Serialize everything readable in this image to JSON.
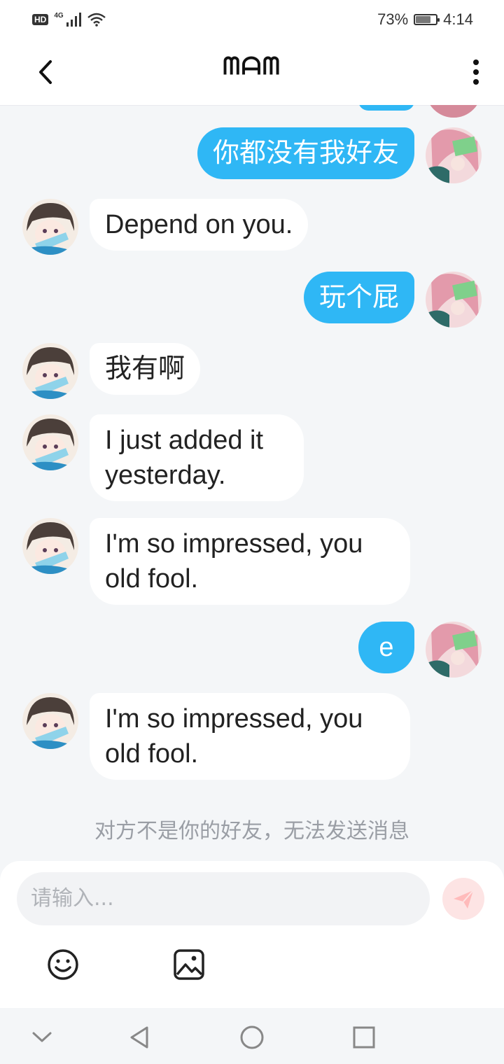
{
  "status_bar": {
    "hd": "HD",
    "network": "4G",
    "battery_percent": "73%",
    "battery_level": 0.73,
    "time": "4:14"
  },
  "header": {
    "title": "ᗰᗩᗰ",
    "back_icon": "chevron-left-icon",
    "more_icon": "more-vertical-icon"
  },
  "messages": [
    {
      "side": "right",
      "text": "你都没有我好友"
    },
    {
      "side": "left",
      "text": "Depend on you."
    },
    {
      "side": "right",
      "text": "玩个屁"
    },
    {
      "side": "left",
      "text": "我有啊"
    },
    {
      "side": "left",
      "text": "I just added it yesterday."
    },
    {
      "side": "left",
      "text": "I'm so impressed, you old fool."
    },
    {
      "side": "right",
      "text": "e"
    },
    {
      "side": "left",
      "text": "I'm so impressed, you old fool."
    }
  ],
  "notice": "对方不是你的好友，无法发送消息",
  "composer": {
    "placeholder": "请输入...",
    "send_icon": "send-icon",
    "emoji_icon": "emoji-icon",
    "image_icon": "image-icon"
  },
  "nav_bar": {
    "icons": [
      "chevron-down-icon",
      "back-triangle-icon",
      "home-circle-icon",
      "recents-square-icon"
    ]
  },
  "colors": {
    "accent": "#2fb7f5",
    "background": "#f4f6f8",
    "send_button": "#fde4e4"
  }
}
